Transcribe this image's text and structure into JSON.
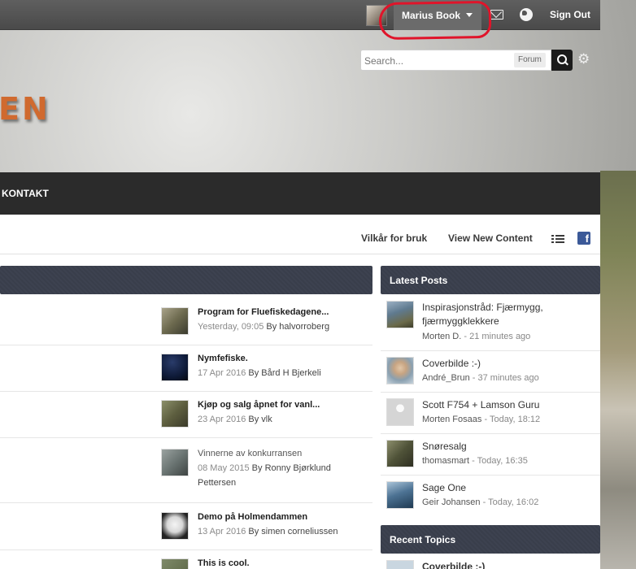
{
  "header": {
    "user_name": "Marius Book",
    "sign_out": "Sign Out",
    "logo_text": "EN"
  },
  "search": {
    "placeholder": "Search...",
    "scope": "Forum"
  },
  "nav": {
    "items": [
      {
        "label": "KONTAKT"
      }
    ]
  },
  "subnav": {
    "terms": "Vilkår for bruk",
    "new_content": "View New Content"
  },
  "topics": [
    {
      "title": "Program for Fluefiskedagene...",
      "date": "Yesterday, 09:05",
      "by": "By halvorroberg"
    },
    {
      "title": "Nymfefiske.",
      "date": "17 Apr 2016",
      "by": "By Bård H Bjerkeli"
    },
    {
      "title": "Kjøp og salg åpnet for vanl...",
      "date": "23 Apr 2016",
      "by": "By vlk"
    },
    {
      "title": "Vinnerne av konkurransen",
      "date": "08 May 2015",
      "by": "By Ronny Bjørklund",
      "by2": "Pettersen"
    },
    {
      "title": "Demo på Holmendammen",
      "date": "13 Apr 2016",
      "by": "By simen corneliussen"
    },
    {
      "title": "This is cool."
    }
  ],
  "sidebar": {
    "latest_title": "Latest Posts",
    "recent_title": "Recent Topics",
    "posts": [
      {
        "title": "Inspirasjonstråd: Fjærmygg, fjærmyggklekkere",
        "author": "Morten D.",
        "time": "- 21 minutes ago"
      },
      {
        "title": "Coverbilde :-)",
        "author": "André_Brun",
        "time": "- 37 minutes ago"
      },
      {
        "title": "Scott F754 + Lamson Guru",
        "author": "Morten Fosaas",
        "time": "- Today, 18:12"
      },
      {
        "title": "Snøresalg",
        "author": "thomasmart",
        "time": "- Today, 16:35"
      },
      {
        "title": "Sage One",
        "author": "Geir Johansen",
        "time": "- Today, 16:02"
      }
    ],
    "recent_first": "Coverbilde :-)"
  },
  "colors": {
    "highlight": "#e0142a",
    "facebook": "#3b5998",
    "logo": "#d06a2f"
  }
}
